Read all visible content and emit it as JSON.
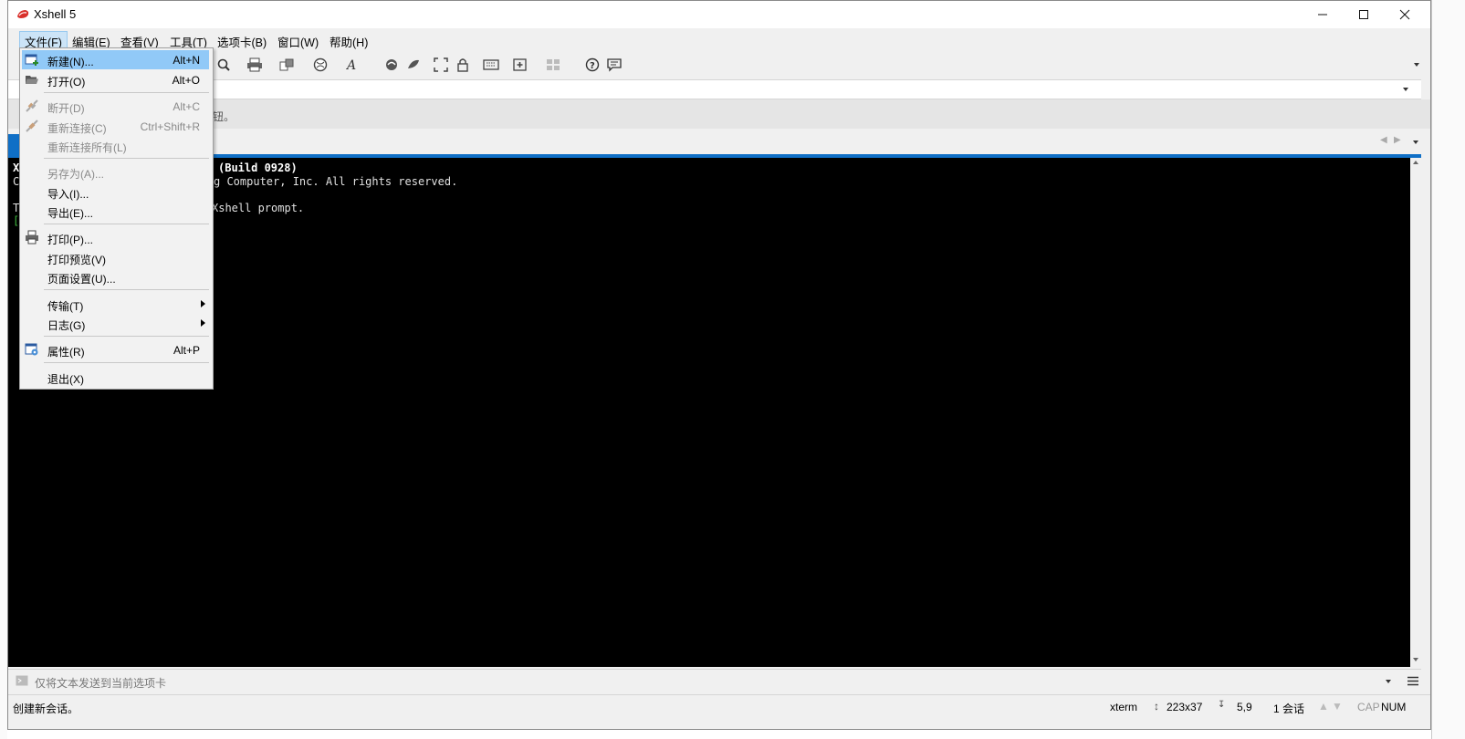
{
  "window": {
    "title": "Xshell 5"
  },
  "menubar": {
    "items": [
      "文件(F)",
      "编辑(E)",
      "查看(V)",
      "工具(T)",
      "选项卡(B)",
      "窗口(W)",
      "帮助(H)"
    ],
    "active_index": 0
  },
  "infobar": {
    "text_fragment": "钮。"
  },
  "terminal": {
    "lines": [
      {
        "text": "X",
        "bold": true
      },
      {
        "text": "C"
      },
      {
        "text": ""
      },
      {
        "text": "T"
      },
      {
        "text": "[",
        "color": "#3fb93f"
      }
    ],
    "visible_fragments": [
      "(Build 0928)",
      "g Computer, Inc. All rights reserved.",
      "Xshell prompt."
    ]
  },
  "file_menu": {
    "items": [
      {
        "label": "新建(N)...",
        "accel": "Alt+N",
        "icon": "new-session-icon",
        "highlighted": true,
        "disabled": false
      },
      {
        "label": "打开(O)",
        "accel": "Alt+O",
        "icon": "open-folder-icon",
        "disabled": false
      },
      {
        "separator": true
      },
      {
        "label": "断开(D)",
        "accel": "Alt+C",
        "icon": "disconnect-icon",
        "disabled": true
      },
      {
        "label": "重新连接(C)",
        "accel": "Ctrl+Shift+R",
        "icon": "reconnect-icon",
        "disabled": true
      },
      {
        "label": "重新连接所有(L)",
        "accel": "",
        "disabled": true
      },
      {
        "separator": true
      },
      {
        "label": "另存为(A)...",
        "accel": "",
        "disabled": true
      },
      {
        "label": "导入(I)...",
        "accel": "",
        "disabled": false
      },
      {
        "label": "导出(E)...",
        "accel": "",
        "disabled": false
      },
      {
        "separator": true
      },
      {
        "label": "打印(P)...",
        "accel": "",
        "icon": "printer-icon",
        "disabled": false
      },
      {
        "label": "打印预览(V)",
        "accel": "",
        "disabled": false
      },
      {
        "label": "页面设置(U)...",
        "accel": "",
        "disabled": false
      },
      {
        "separator": true
      },
      {
        "label": "传输(T)",
        "accel": "",
        "submenu": true,
        "disabled": false
      },
      {
        "label": "日志(G)",
        "accel": "",
        "submenu": true,
        "disabled": false
      },
      {
        "separator": true
      },
      {
        "label": "属性(R)",
        "accel": "Alt+P",
        "icon": "properties-icon",
        "disabled": false
      },
      {
        "separator": true
      },
      {
        "label": "退出(X)",
        "accel": "",
        "disabled": false
      }
    ]
  },
  "sendbar": {
    "placeholder": "仅将文本发送到当前选项卡"
  },
  "statusbar": {
    "message": "创建新会话。",
    "terminal_type": "xterm",
    "size": "223x37",
    "cursor": "5,9",
    "sessions": "1 会话",
    "cap": "CAP",
    "num": "NUM"
  },
  "colors": {
    "accent": "#0f6fc6",
    "menu_highlight": "#91c9f7",
    "terminal_bg": "#000000"
  }
}
